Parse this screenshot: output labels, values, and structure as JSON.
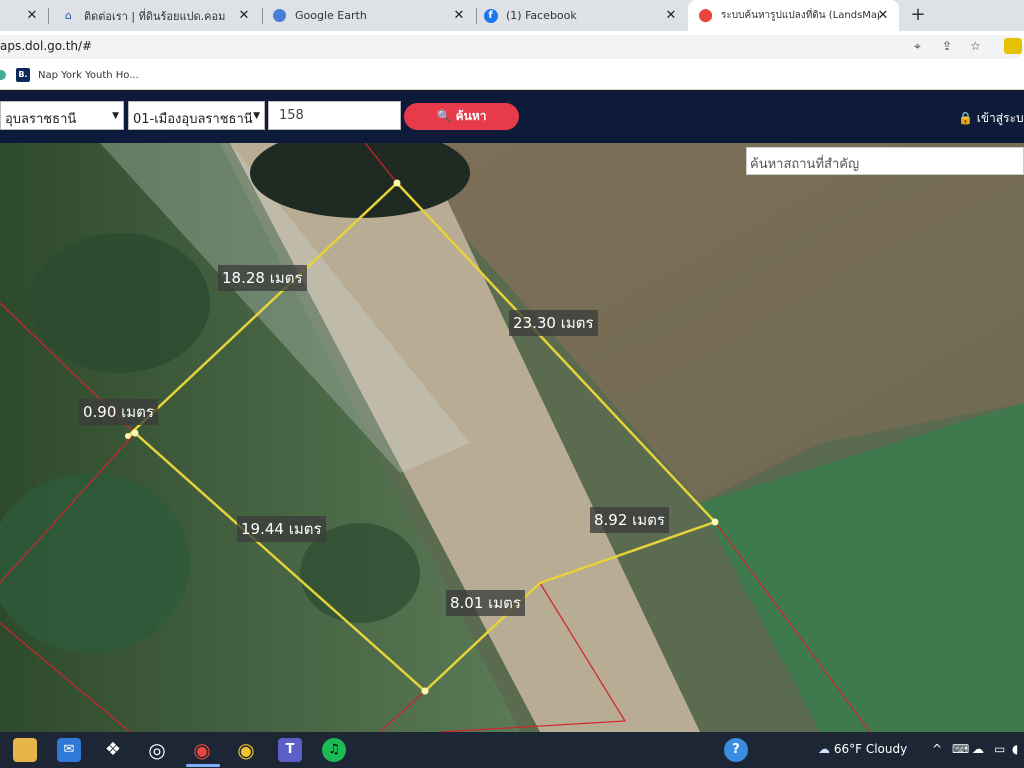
{
  "browser": {
    "tabs": [
      {
        "title": "",
        "icon": "tab-favicon"
      },
      {
        "title": "ติดต่อเรา | ที่ดินร้อยแปด.คอม",
        "icon": "home-icon"
      },
      {
        "title": "Google Earth",
        "icon": "google-earth-icon"
      },
      {
        "title": "(1) Facebook",
        "icon": "facebook-icon"
      },
      {
        "title": "ระบบค้นหารูปแปลงที่ดิน (LandsMaps",
        "icon": "map-pin-icon"
      }
    ],
    "close_glyph": "✕",
    "new_tab_glyph": "+",
    "url": "aps.dol.go.th/#",
    "bookmarks": [
      {
        "label": "Nap York Youth Ho...",
        "icon_text": "B."
      }
    ]
  },
  "site": {
    "province": "อุบลราชธานี",
    "district": "01-เมืองอุบลราชธานี",
    "parcel_number": "158",
    "search_label": "🔍 ค้นหา",
    "login_label": "🔒 เข้าสู่ระบบ",
    "place_search_placeholder": "ค้นหาสถานที่สำคัญ"
  },
  "map": {
    "measurements": [
      {
        "label": "18.28 เมตร"
      },
      {
        "label": "23.30 เมตร"
      },
      {
        "label": "0.90 เมตร"
      },
      {
        "label": "8.92 เมตร"
      },
      {
        "label": "19.44 เมตร"
      },
      {
        "label": "8.01 เมตร"
      }
    ],
    "colors": {
      "parcel_outline": "#e6d23a",
      "boundary_red": "#d2232a"
    }
  },
  "taskbar": {
    "apps": [
      {
        "name": "file-explorer-icon",
        "glyph": "📁"
      },
      {
        "name": "mail-icon",
        "glyph": "✉"
      },
      {
        "name": "dropbox-icon",
        "glyph": "❖"
      },
      {
        "name": "github-icon",
        "glyph": "◎"
      },
      {
        "name": "chrome-icon-1",
        "glyph": "◉"
      },
      {
        "name": "chrome-icon-2",
        "glyph": "◉"
      },
      {
        "name": "teams-icon",
        "glyph": "T"
      },
      {
        "name": "spotify-icon",
        "glyph": "♫"
      },
      {
        "name": "help-icon",
        "glyph": "?"
      }
    ],
    "weather": "66°F  Cloudy",
    "tray_glyphs": "^"
  }
}
